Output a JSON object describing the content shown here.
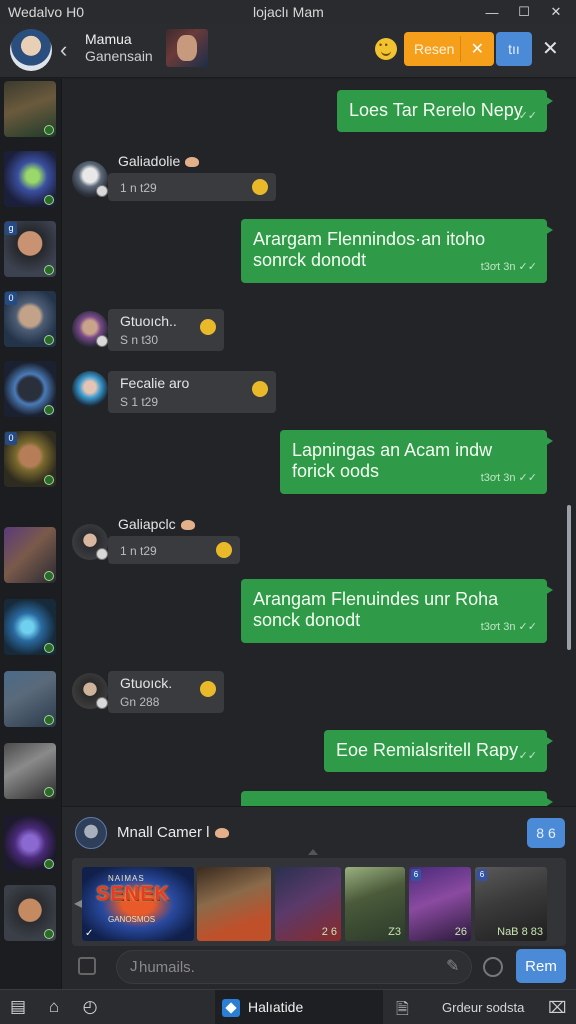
{
  "titlebar": {
    "app_title": "Wedalvo H0",
    "window_title": "lojaclı Mam"
  },
  "header": {
    "chat_name": "Mamua",
    "chat_subtitle": "Ganensain",
    "orange_button_label": "Resen",
    "blue_button_label": "tıı"
  },
  "sidebar": {
    "badges": [
      "",
      "",
      "g",
      "0",
      "",
      "0",
      "",
      "",
      "",
      "",
      "",
      "",
      "",
      ""
    ]
  },
  "messages": [
    {
      "type": "out",
      "text": "Loes Tar Rerelo Nepy",
      "meta": ""
    },
    {
      "type": "in",
      "name": "Galiadolie",
      "text": "1 n t29"
    },
    {
      "type": "out",
      "text": "Arargam Flennindos·an itoho sonrck donodt",
      "meta": "t3ơt 3n"
    },
    {
      "type": "in",
      "name": "Gtuoıch..",
      "text": "S n t30"
    },
    {
      "type": "in",
      "name": "Fecalie aro",
      "text": "S 1 t29"
    },
    {
      "type": "out",
      "text": "Lapningas an Acam indw forick oods",
      "meta": "t3ơt 3n"
    },
    {
      "type": "in",
      "name": "Galiapclc",
      "text": "1 n t29"
    },
    {
      "type": "out",
      "text": "Arangam Flenuindes unr Roha sonck donodt",
      "meta": "t3ơt 3n"
    },
    {
      "type": "in",
      "name": "Gtuoıck.",
      "text": "Gn 288"
    },
    {
      "type": "out",
      "text": "Eoe Remialsritell Rapy",
      "meta": ""
    }
  ],
  "composer": {
    "name": "Mnall Camer l",
    "blue_button_label": "8 6",
    "strip_tiles": [
      {
        "label_top": "NAIMAS",
        "title": "SENEK",
        "sub": "GANOSMOS",
        "num": ""
      },
      {
        "label_top": "",
        "title": "",
        "sub": "",
        "num": ""
      },
      {
        "label_top": "",
        "title": "",
        "sub": "",
        "num": "2 6"
      },
      {
        "label_top": "",
        "title": "",
        "sub": "",
        "num": "Z3"
      },
      {
        "label_top": "",
        "title": "",
        "sub": "",
        "num": "26"
      },
      {
        "label_top": "",
        "title": "",
        "sub": "",
        "num": "NaB  8 83"
      }
    ],
    "input_placeholder": "humails.",
    "input_prefix": "J",
    "send_label": "Rem"
  },
  "taskbar": {
    "active_label": "Halıatide",
    "right_text": "Grdeur sodsta"
  }
}
